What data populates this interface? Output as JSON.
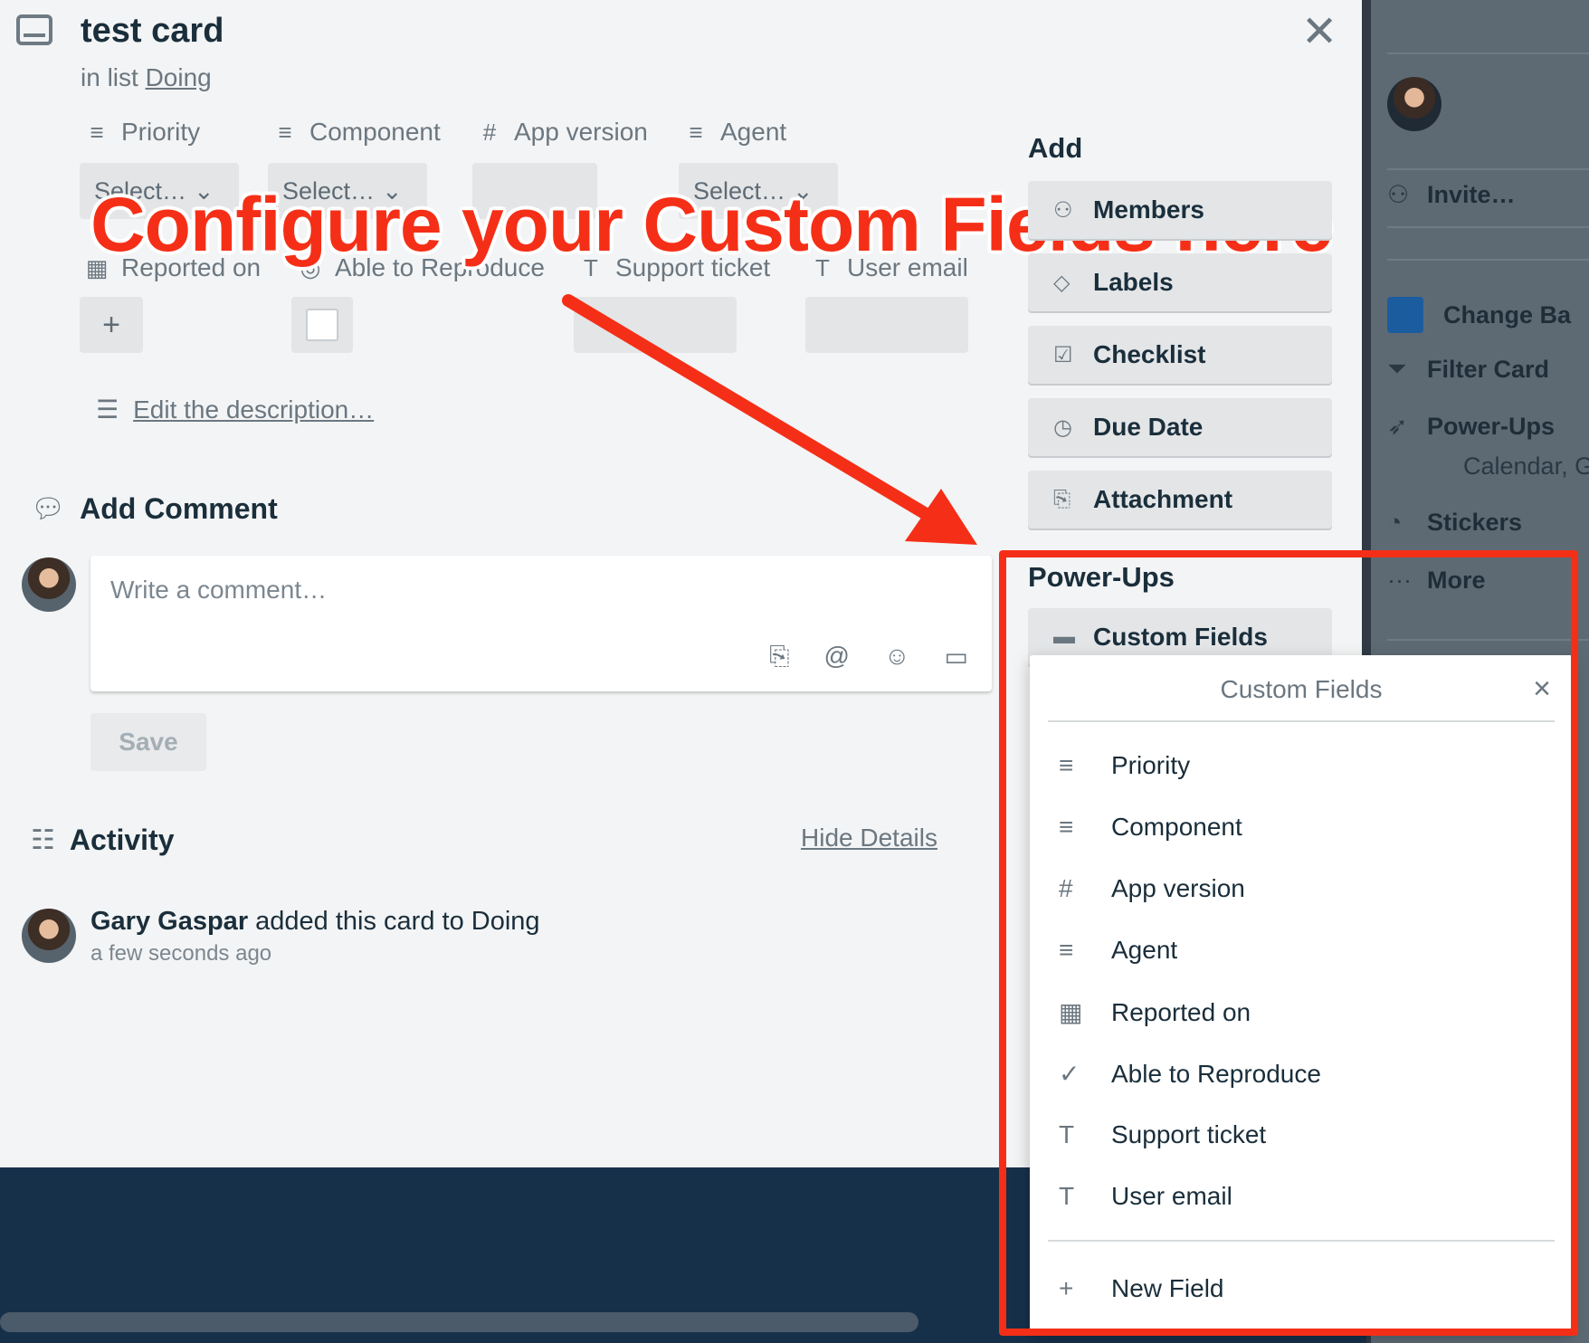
{
  "card": {
    "title": "test card",
    "list_prefix": "in list ",
    "list_name": "Doing"
  },
  "fields_row1": [
    {
      "label": "Priority",
      "icon": "≡",
      "value": "Select…"
    },
    {
      "label": "Component",
      "icon": "≡",
      "value": "Select…"
    },
    {
      "label": "App version",
      "icon": "#",
      "value": ""
    },
    {
      "label": "Agent",
      "icon": "≡",
      "value": "Select…"
    }
  ],
  "fields_row2": [
    {
      "label": "Reported on",
      "icon": "▦",
      "value": "+"
    },
    {
      "label": "Able to Reproduce",
      "icon": "◎",
      "value": ""
    },
    {
      "label": "Support ticket",
      "icon": "T",
      "value": ""
    },
    {
      "label": "User email",
      "icon": "T",
      "value": ""
    }
  ],
  "annotation": {
    "callout": "Configure your Custom Fields here",
    "color": "#f52f17"
  },
  "description": {
    "link": "Edit the description…"
  },
  "comment": {
    "heading": "Add Comment",
    "placeholder": "Write a comment…",
    "save": "Save"
  },
  "activity": {
    "heading": "Activity",
    "hide_details": "Hide Details",
    "entry_user": "Gary Gaspar",
    "entry_text": " added this card to Doing",
    "entry_time": "a few seconds ago"
  },
  "sidebar": {
    "add_heading": "Add",
    "add_buttons": [
      {
        "label": "Members",
        "icon": "person-icon"
      },
      {
        "label": "Labels",
        "icon": "tag-icon"
      },
      {
        "label": "Checklist",
        "icon": "checkbox-icon"
      },
      {
        "label": "Due Date",
        "icon": "clock-icon"
      },
      {
        "label": "Attachment",
        "icon": "paperclip-icon"
      }
    ],
    "powerups_heading": "Power-Ups",
    "custom_fields_button": "Custom Fields"
  },
  "popover": {
    "title": "Custom Fields",
    "close": "×",
    "items": [
      {
        "label": "Priority",
        "icon": "≡"
      },
      {
        "label": "Component",
        "icon": "≡"
      },
      {
        "label": "App version",
        "icon": "#"
      },
      {
        "label": "Agent",
        "icon": "≡"
      },
      {
        "label": "Reported on",
        "icon": "▦"
      },
      {
        "label": "Able to Reproduce",
        "icon": "✓"
      },
      {
        "label": "Support ticket",
        "icon": "T"
      },
      {
        "label": "User email",
        "icon": "T"
      }
    ],
    "new_field": "New Field"
  },
  "board_menu": {
    "invite": "Invite…",
    "items": [
      "Change Ba",
      "Filter Card",
      "Power-Ups",
      "Stickers",
      "More"
    ],
    "powerups_sub": "Calendar, G"
  }
}
